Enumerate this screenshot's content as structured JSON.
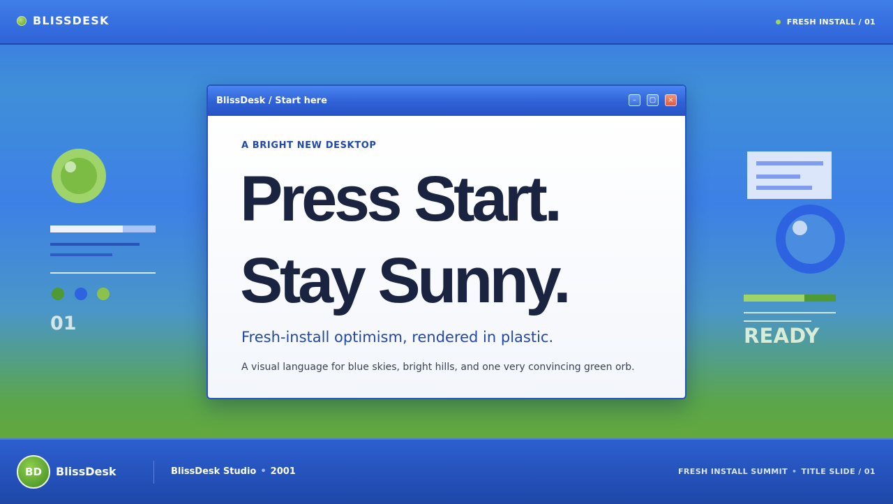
{
  "topbar": {
    "brand_name": "BLISSDESK",
    "status_label": "FRESH INSTALL / 01"
  },
  "left_panel": {
    "number": "01",
    "dots": [
      "#4f9a32",
      "#2d63e0",
      "#8bc34a"
    ]
  },
  "right_panel": {
    "status_word": "READY",
    "progress": 0.66
  },
  "window": {
    "title": "BlissDesk / Start here",
    "controls": {
      "minimize": "–",
      "maximize": "▢",
      "close": "×"
    },
    "kicker": "A BRIGHT NEW DESKTOP",
    "headline_line1": "Press Start.",
    "headline_line2": "Stay Sunny.",
    "subhead": "Fresh-install optimism, rendered in plastic.",
    "description": "A visual language for blue skies, bright hills, and one very convincing green orb."
  },
  "footer": {
    "badge": "BD",
    "brand": "BlissDesk",
    "studio": "BlissDesk Studio",
    "year": "2001",
    "event": "FRESH INSTALL SUMMIT",
    "slide": "TITLE SLIDE / 01"
  },
  "colors": {
    "accent_blue": "#2553c4",
    "accent_green": "#9fd46a",
    "headline": "#1a2440"
  }
}
